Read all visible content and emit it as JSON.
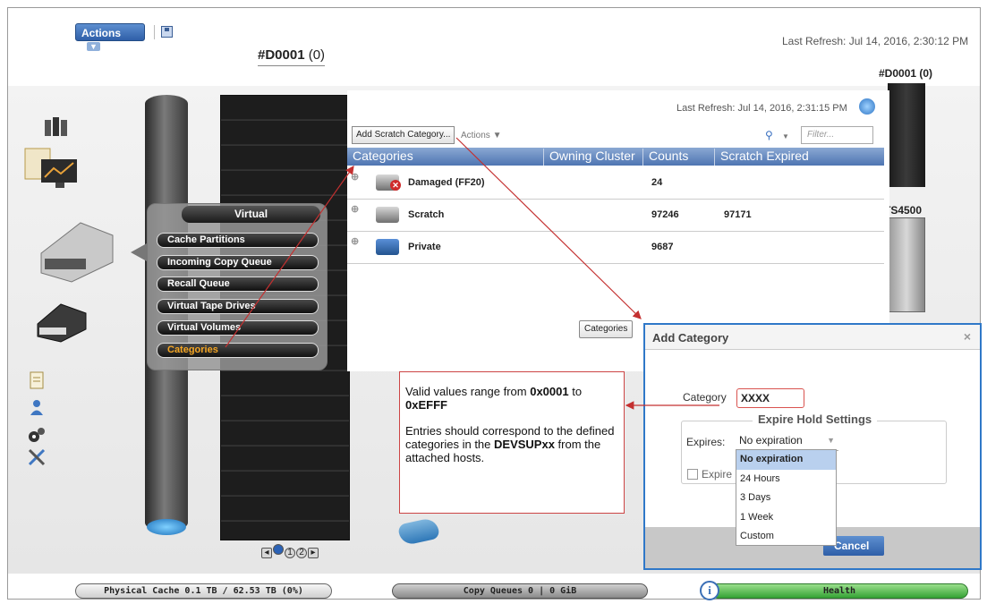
{
  "toolbar": {
    "actions_label": "Actions",
    "actions_caret": "▼"
  },
  "header": {
    "title": "#D0001",
    "title_count": "(0)",
    "last_refresh": "Last Refresh:  Jul 14, 2016, 2:30:12 PM"
  },
  "right_side": {
    "cluster_label": "#D0001 (0)",
    "library_label": "TS4500"
  },
  "virtual_menu": {
    "title": "Virtual",
    "items": [
      {
        "label": "Cache Partitions",
        "active": false
      },
      {
        "label": "Incoming Copy Queue",
        "active": false
      },
      {
        "label": "Recall Queue",
        "active": false
      },
      {
        "label": "Virtual Tape Drives",
        "active": false
      },
      {
        "label": "Virtual Volumes",
        "active": false
      },
      {
        "label": "Categories",
        "active": true
      }
    ]
  },
  "categories_panel": {
    "last_refresh": "Last Refresh:  Jul 14, 2016, 2:31:15 PM",
    "add_scratch_label": "Add Scratch Category...",
    "actions_label": "Actions ▼",
    "search_caret": "▼",
    "filter_placeholder": "Filter...",
    "columns": [
      "Categories",
      "Owning Cluster",
      "Counts",
      "Scratch Expired"
    ],
    "rows": [
      {
        "expander": "⊕",
        "name": "Damaged (FF20)",
        "owning_cluster": "",
        "counts": "24",
        "scratch_expired": "",
        "error": true
      },
      {
        "expander": "⊕",
        "name": "Scratch",
        "owning_cluster": "",
        "counts": "97246",
        "scratch_expired": "97171",
        "error": false
      },
      {
        "expander": "⊕",
        "name": "Private",
        "owning_cluster": "",
        "counts": "9687",
        "scratch_expired": "",
        "error": false
      }
    ],
    "categories_button": "Categories"
  },
  "callout": {
    "line1_pre": "Valid values range from ",
    "line1_bold1": "0x0001",
    "line1_mid": " to ",
    "line1_bold2": "0xEFFF",
    "line2_pre": "Entries should correspond to the defined categories in the ",
    "line2_bold": "DEVSUPxx",
    "line2_post": " from the attached hosts."
  },
  "add_category_dialog": {
    "title": "Add Category",
    "close": "×",
    "category_label": "Category",
    "category_value": "XXXX",
    "fieldset_legend": "Expire Hold Settings",
    "expires_label": "Expires:",
    "expires_selected": "No expiration",
    "expire_hold_label": "Expire",
    "options": [
      "No expiration",
      "24 Hours",
      "3 Days",
      "1 Week",
      "Custom"
    ],
    "cancel_label": "Cancel"
  },
  "pager": {
    "prev": "◂",
    "next": "▸",
    "pages": [
      "",
      "1",
      "2"
    ]
  },
  "status_bar": {
    "physical_cache": "Physical Cache 0.1 TB / 62.53 TB (0%)",
    "copy_queues": "Copy Queues 0 | 0 GiB",
    "info": "i",
    "health": "Health"
  },
  "colors": {
    "accent": "#2f78c8",
    "callout_border": "#cc4444",
    "health": "#35a335",
    "active_menu": "#f5a623"
  }
}
